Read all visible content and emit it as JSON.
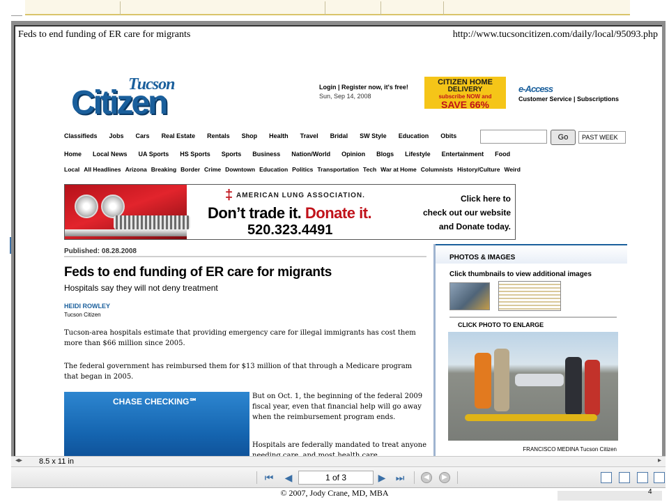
{
  "page": {
    "title": "Feds to end funding of ER care for migrants",
    "url": "http://www.tucsoncitizen.com/daily/local/95093.php"
  },
  "masthead": {
    "logo_top": "Tucson",
    "logo_main": "Citizen",
    "login": "Login | Register now, it's free!",
    "date": "Sun, Sep 14, 2008",
    "delivery": [
      "CITIZEN HOME",
      "DELIVERY",
      "subscribe NOW and",
      "SAVE 66%"
    ],
    "access": "e-Access",
    "customer": "Customer Service | Subscriptions"
  },
  "nav_primary": [
    "Classifieds",
    "Jobs",
    "Cars",
    "Real Estate",
    "Rentals",
    "Shop",
    "Health",
    "Travel",
    "Bridal",
    "SW Style",
    "Education",
    "Obits"
  ],
  "search": {
    "go_label": "Go",
    "range": "PAST WEEK"
  },
  "nav_secondary": [
    "Home",
    "Local News",
    "UA Sports",
    "HS Sports",
    "Sports",
    "Business",
    "Nation/World",
    "Opinion",
    "Blogs",
    "Lifestyle",
    "Entertainment",
    "Food"
  ],
  "nav_tertiary": [
    "Local",
    "All Headlines",
    "Arizona",
    "Breaking",
    "Border",
    "Crime",
    "Downtown",
    "Education",
    "Politics",
    "Transportation",
    "Tech",
    "War at Home",
    "Columnists",
    "History/Culture",
    "Weird"
  ],
  "banner": {
    "cross": "‡",
    "org": "AMERICAN LUNG ASSOCIATION.",
    "slogan_a": "Don’t trade it.",
    "slogan_b": "Donate it.",
    "phone": "520.323.4491",
    "cta": [
      "Click here to",
      "check out our website",
      "and Donate today."
    ]
  },
  "article": {
    "published": "Published: 08.28.2008",
    "headline": "Feds to end funding of ER care for migrants",
    "subhead": "Hospitals say they will not deny treatment",
    "author": "HEIDI ROWLEY",
    "source": "Tucson Citizen",
    "p1": "Tucson-area hospitals estimate that providing emergency care for illegal immigrants has cost them more than $66 million since 2005.",
    "p2": "The federal government has reimbursed them for $13 million of that through a Medicare program that began in 2005.",
    "p3": "But on Oct. 1, the beginning of the federal 2009 fiscal year, even that financial help will go away when the reimbursement program ends.",
    "p4": "Hospitals are federally mandated to treat anyone needing care, and most health care",
    "ad": "CHASE CHECKING℠"
  },
  "photos": {
    "title": "PHOTOS & IMAGES",
    "hint": "Click thumbnails to view additional images",
    "enlarge": "CLICK PHOTO TO ENLARGE",
    "credit": "FRANCISCO MEDINA Tucson Citizen"
  },
  "viewer": {
    "paper_size": "8.5 x 11 in",
    "page_indicator": "1 of 3"
  },
  "slide": {
    "copyright": "© 2007, Jody Crane, MD, MBA",
    "number": "4"
  }
}
